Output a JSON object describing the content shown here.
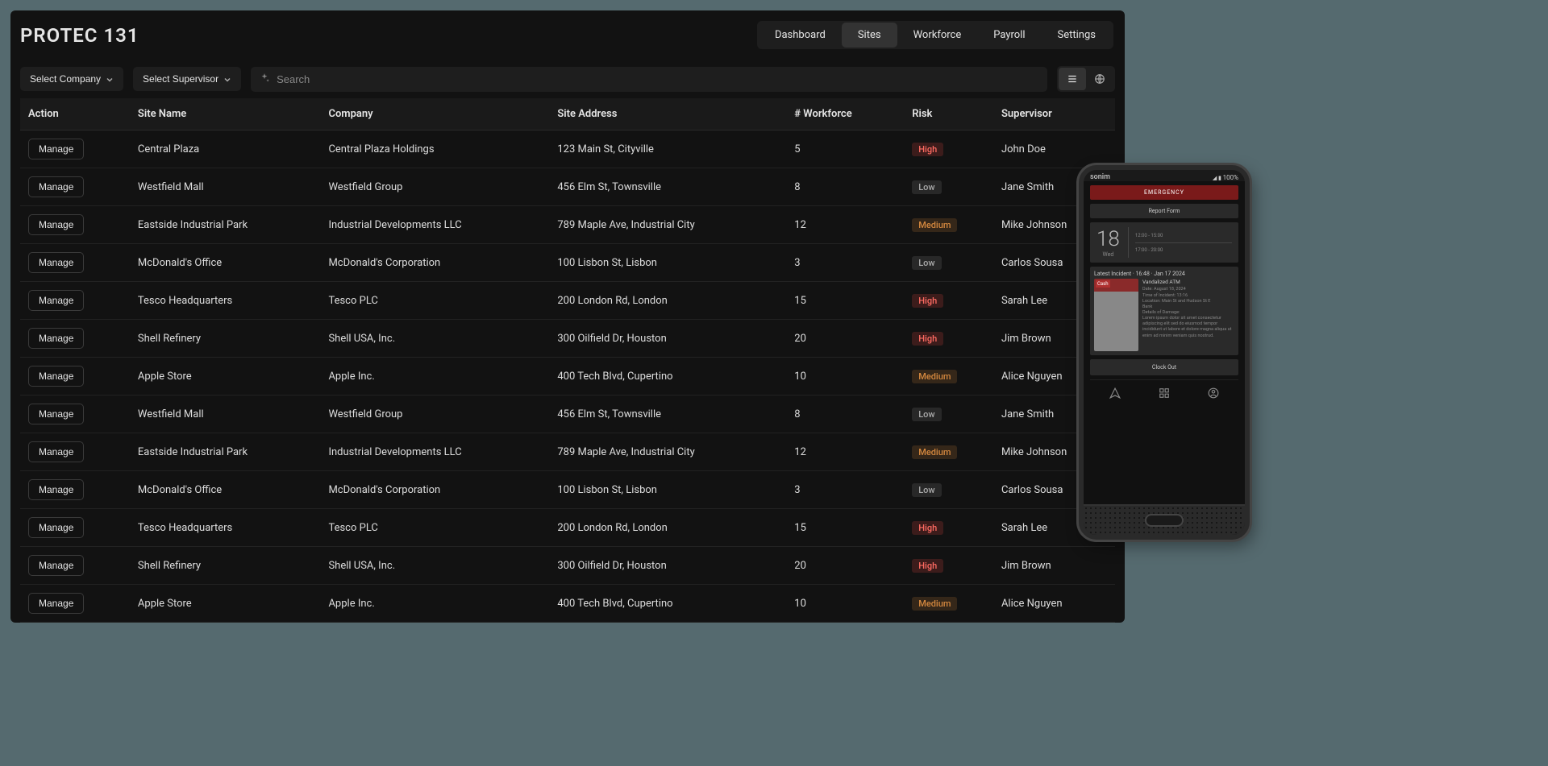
{
  "app_title": "PROTEC 131",
  "nav": {
    "tabs": [
      {
        "label": "Dashboard",
        "active": false
      },
      {
        "label": "Sites",
        "active": true
      },
      {
        "label": "Workforce",
        "active": false
      },
      {
        "label": "Payroll",
        "active": false
      },
      {
        "label": "Settings",
        "active": false
      }
    ]
  },
  "toolbar": {
    "company_dropdown": "Select Company",
    "supervisor_dropdown": "Select Supervisor",
    "search_placeholder": "Search"
  },
  "table": {
    "columns": [
      "Action",
      "Site Name",
      "Company",
      "Site Address",
      "# Workforce",
      "Risk",
      "Supervisor"
    ],
    "manage_label": "Manage",
    "rows": [
      {
        "site": "Central Plaza",
        "company": "Central Plaza Holdings",
        "address": "123 Main St, Cityville",
        "workforce": "5",
        "risk": "High",
        "supervisor": "John Doe"
      },
      {
        "site": "Westfield Mall",
        "company": "Westfield Group",
        "address": "456 Elm St, Townsville",
        "workforce": "8",
        "risk": "Low",
        "supervisor": "Jane Smith"
      },
      {
        "site": "Eastside Industrial Park",
        "company": "Industrial Developments LLC",
        "address": "789 Maple Ave, Industrial City",
        "workforce": "12",
        "risk": "Medium",
        "supervisor": "Mike Johnson"
      },
      {
        "site": "McDonald's Office",
        "company": "McDonald's Corporation",
        "address": "100 Lisbon St, Lisbon",
        "workforce": "3",
        "risk": "Low",
        "supervisor": "Carlos Sousa"
      },
      {
        "site": "Tesco Headquarters",
        "company": "Tesco PLC",
        "address": "200 London Rd, London",
        "workforce": "15",
        "risk": "High",
        "supervisor": "Sarah Lee"
      },
      {
        "site": "Shell Refinery",
        "company": "Shell USA, Inc.",
        "address": "300 Oilfield Dr, Houston",
        "workforce": "20",
        "risk": "High",
        "supervisor": "Jim Brown"
      },
      {
        "site": "Apple Store",
        "company": "Apple Inc.",
        "address": "400 Tech Blvd, Cupertino",
        "workforce": "10",
        "risk": "Medium",
        "supervisor": "Alice Nguyen"
      },
      {
        "site": "Westfield Mall",
        "company": "Westfield Group",
        "address": "456 Elm St, Townsville",
        "workforce": "8",
        "risk": "Low",
        "supervisor": "Jane Smith"
      },
      {
        "site": "Eastside Industrial Park",
        "company": "Industrial Developments LLC",
        "address": "789 Maple Ave, Industrial City",
        "workforce": "12",
        "risk": "Medium",
        "supervisor": "Mike Johnson"
      },
      {
        "site": "McDonald's Office",
        "company": "McDonald's Corporation",
        "address": "100 Lisbon St, Lisbon",
        "workforce": "3",
        "risk": "Low",
        "supervisor": "Carlos Sousa"
      },
      {
        "site": "Tesco Headquarters",
        "company": "Tesco PLC",
        "address": "200 London Rd, London",
        "workforce": "15",
        "risk": "High",
        "supervisor": "Sarah Lee"
      },
      {
        "site": "Shell Refinery",
        "company": "Shell USA, Inc.",
        "address": "300 Oilfield Dr, Houston",
        "workforce": "20",
        "risk": "High",
        "supervisor": "Jim Brown"
      },
      {
        "site": "Apple Store",
        "company": "Apple Inc.",
        "address": "400 Tech Blvd, Cupertino",
        "workforce": "10",
        "risk": "Medium",
        "supervisor": "Alice Nguyen"
      }
    ]
  },
  "phone": {
    "brand": "sonim",
    "battery": "100%",
    "emergency_label": "EMERGENCY",
    "report_label": "Report Form",
    "date_num": "18",
    "date_day": "Wed",
    "slot1": "12:00 - 15:00",
    "slot2": "17:00 - 20:00",
    "incident_header": "Latest Incident · 16:48 · Jan 17 2024",
    "incident_title": "Vandalized ATM",
    "incident_line1": "Date: August 18, 2024",
    "incident_line2": "Time of Incident: 13:16",
    "incident_line3": "Location: Main St and Hudson St E",
    "incident_line4": "Bank",
    "incident_line5": "Details of Damage:",
    "incident_body": "Lorem ipsum dolor sit amet consectetur adipiscing elit sed do eiusmod tempor incididunt ut labore et dolore magna aliqua ut enim ad minim veniam quis nostrud.",
    "clock_out": "Clock Out"
  }
}
